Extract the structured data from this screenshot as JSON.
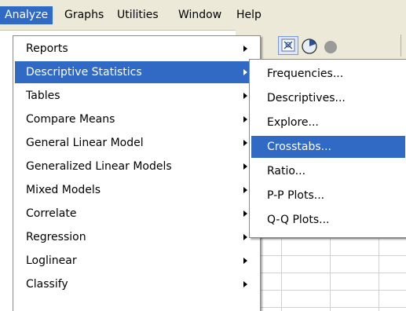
{
  "menubar": {
    "items": [
      {
        "label": "Analyze",
        "active": true
      },
      {
        "label": "Graphs",
        "active": false
      },
      {
        "label": "Utilities",
        "active": false
      },
      {
        "label": "Window",
        "active": false
      },
      {
        "label": "Help",
        "active": false
      }
    ]
  },
  "analyze_menu": {
    "items": [
      {
        "label": "Reports",
        "has_submenu": true,
        "highlighted": false
      },
      {
        "label": "Descriptive Statistics",
        "has_submenu": true,
        "highlighted": true
      },
      {
        "label": "Tables",
        "has_submenu": true,
        "highlighted": false
      },
      {
        "label": "Compare Means",
        "has_submenu": true,
        "highlighted": false
      },
      {
        "label": "General Linear Model",
        "has_submenu": true,
        "highlighted": false
      },
      {
        "label": "Generalized Linear Models",
        "has_submenu": true,
        "highlighted": false
      },
      {
        "label": "Mixed Models",
        "has_submenu": true,
        "highlighted": false
      },
      {
        "label": "Correlate",
        "has_submenu": true,
        "highlighted": false
      },
      {
        "label": "Regression",
        "has_submenu": true,
        "highlighted": false
      },
      {
        "label": "Loglinear",
        "has_submenu": true,
        "highlighted": false
      },
      {
        "label": "Classify",
        "has_submenu": true,
        "highlighted": false
      }
    ]
  },
  "descriptive_submenu": {
    "items": [
      {
        "label": "Frequencies...",
        "highlighted": false
      },
      {
        "label": "Descriptives...",
        "highlighted": false
      },
      {
        "label": "Explore...",
        "highlighted": false
      },
      {
        "label": "Crosstabs...",
        "highlighted": true
      },
      {
        "label": "Ratio...",
        "highlighted": false
      },
      {
        "label": "P-P Plots...",
        "highlighted": false
      },
      {
        "label": "Q-Q Plots...",
        "highlighted": false
      }
    ]
  },
  "toolbar": {
    "icons": [
      "select-cases-icon",
      "chart-icon",
      "circle-icon"
    ]
  },
  "colors": {
    "highlight": "#316ac5",
    "menubar_bg": "#ece9d8",
    "menu_bg": "#ffffff"
  }
}
